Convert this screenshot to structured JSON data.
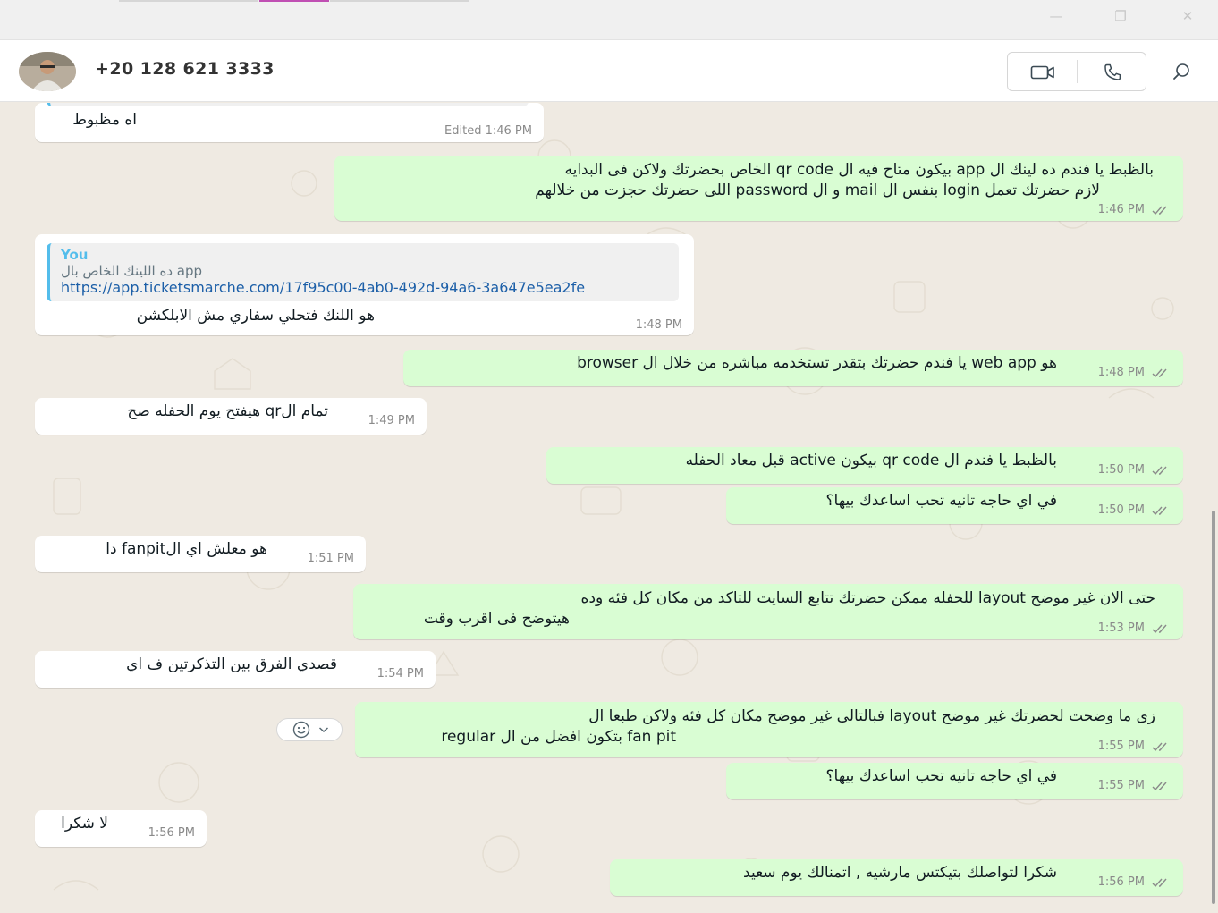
{
  "window": {
    "minimize_glyph": "—",
    "maximize_glyph": "❐",
    "close_glyph": "✕"
  },
  "header": {
    "contact_name": "+20 128 621 3333",
    "icons": [
      "video-call-icon",
      "voice-call-icon",
      "search-icon"
    ]
  },
  "messages": [
    {
      "id": "m1",
      "dir": "in",
      "lines": [
        "اه مظبوط"
      ],
      "time": "Edited 1:46 PM"
    },
    {
      "id": "m2",
      "dir": "out",
      "lines": [
        "بالظبط يا فندم ده لينك ال app بيكون متاح فيه ال qr code الخاص بحضرتك ولاكن فى البدايه",
        "لازم  حضرتك تعمل login بنفس ال mail و ال password اللى حضرتك حجزت من خلالهم"
      ],
      "time": "1:46 PM"
    },
    {
      "id": "m3",
      "dir": "in",
      "quote": {
        "author": "You",
        "text": "ده اللينك الخاص بال  app",
        "link": "https://app.ticketsmarche.com/17f95c00-4ab0-492d-94a6-3a647e5ea2fe"
      },
      "lines": [
        "هو اللنك فتحلي سفاري مش الابلكشن"
      ],
      "time": "1:48 PM"
    },
    {
      "id": "m4",
      "dir": "out",
      "lines": [
        "هو web app يا فندم حضرتك بتقدر تستخدمه مباشره من خلال ال browser"
      ],
      "time": "1:48 PM"
    },
    {
      "id": "m5",
      "dir": "in",
      "lines": [
        "تمام الqr هيفتح يوم الحفله صح"
      ],
      "time": "1:49 PM"
    },
    {
      "id": "m6",
      "dir": "out",
      "lines": [
        "بالظبط يا فندم ال qr code بيكون active قبل معاد الحفله"
      ],
      "time": "1:50 PM"
    },
    {
      "id": "m7",
      "dir": "out",
      "lines": [
        "في اي حاجه تانيه تحب اساعدك بيها؟"
      ],
      "time": "1:50 PM"
    },
    {
      "id": "m8",
      "dir": "in",
      "lines": [
        "هو معلش اي الfanpit دا"
      ],
      "time": "1:51 PM"
    },
    {
      "id": "m9",
      "dir": "out",
      "lines": [
        "حتى الان غير موضح layout للحفله ممكن حضرتك تتابع السايت للتاكد من مكان كل فئه وده",
        "هيتوضح فى اقرب وقت"
      ],
      "time": "1:53 PM"
    },
    {
      "id": "m10",
      "dir": "in",
      "lines": [
        "قصدي الفرق بين التذكرتين ف اي"
      ],
      "time": "1:54 PM"
    },
    {
      "id": "m11",
      "dir": "out",
      "lines": [
        "زى ما وضحت لحضرتك غير موضح layout  فبالتالى غير موضح مكان كل فئه ولاكن طبعا ال",
        "fan pit بتكون افضل من ال regular"
      ],
      "time": "1:55 PM"
    },
    {
      "id": "m12",
      "dir": "out",
      "lines": [
        "في اي حاجه تانيه تحب اساعدك بيها؟"
      ],
      "time": "1:55 PM"
    },
    {
      "id": "m13",
      "dir": "in",
      "lines": [
        "لا شكرا"
      ],
      "time": "1:56 PM"
    },
    {
      "id": "m14",
      "dir": "out",
      "lines": [
        "شكرا لتواصلك بتيكتس مارشيه , اتمنالك يوم سعيد"
      ],
      "time": "1:56 PM"
    }
  ],
  "colors": {
    "chat_background": "#efeae2",
    "incoming_bubble": "#ffffff",
    "outgoing_bubble": "#d9fdd3",
    "quote_accent": "#53bdeb",
    "link": "#1c5fa8",
    "active_tab": "#c04fb3"
  }
}
